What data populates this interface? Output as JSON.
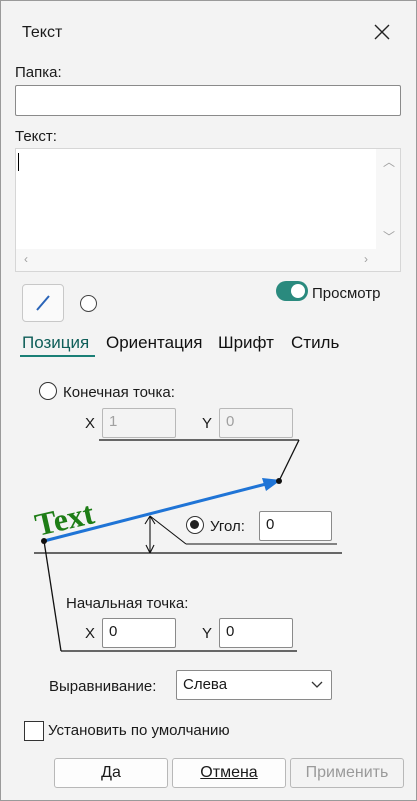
{
  "window": {
    "title": "Текст"
  },
  "folder": {
    "label": "Папка:",
    "value": ""
  },
  "text": {
    "label": "Текст:",
    "value": ""
  },
  "preview": {
    "label": "Просмотр"
  },
  "tabs": [
    "Позиция",
    "Ориентация",
    "Шрифт",
    "Стиль"
  ],
  "position": {
    "end_point": {
      "label": "Конечная точка:",
      "x_label": "X",
      "x_value": "1",
      "y_label": "Y",
      "y_value": "0"
    },
    "angle": {
      "label": "Угол:",
      "value": "0"
    },
    "start_point": {
      "label": "Начальная точка:",
      "x_label": "X",
      "x_value": "0",
      "y_label": "Y",
      "y_value": "0"
    },
    "diagram_text": "Text"
  },
  "alignment": {
    "label": "Выравнивание:",
    "value": "Слева"
  },
  "default": {
    "label": "Установить по умолчанию"
  },
  "buttons": {
    "ok": "Да",
    "cancel": "Отмена",
    "apply": "Применить"
  },
  "colors": {
    "accent": "#1a7f76",
    "diagram_text": "#1e7d16",
    "diagram_arrow": "#1f74d6"
  }
}
